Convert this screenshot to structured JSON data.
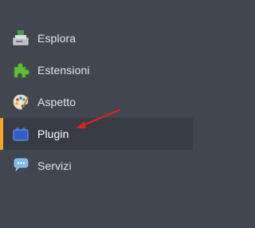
{
  "sidebar": {
    "items": [
      {
        "label": "Esplora",
        "icon": "computer-icon"
      },
      {
        "label": "Estensioni",
        "icon": "puzzle-piece-icon"
      },
      {
        "label": "Aspetto",
        "icon": "palette-icon"
      },
      {
        "label": "Plugin",
        "icon": "plugin-block-icon",
        "active": true
      },
      {
        "label": "Servizi",
        "icon": "chat-bubble-icon"
      }
    ]
  },
  "colors": {
    "background": "#414650",
    "active_background": "#373b44",
    "active_indicator": "#f5a623",
    "annotation_arrow": "#e02020"
  }
}
